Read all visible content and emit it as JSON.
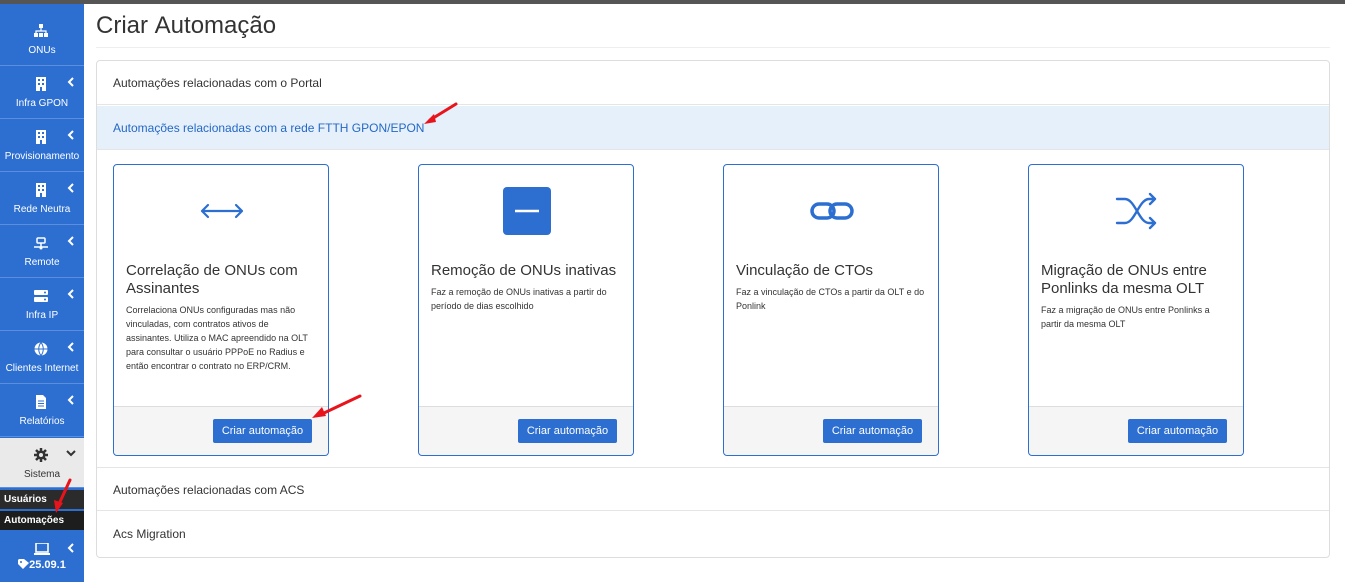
{
  "sidebar": {
    "items": [
      {
        "label": "ONUs",
        "icon": "sitemap-icon"
      },
      {
        "label": "Infra GPON",
        "icon": "building-icon"
      },
      {
        "label": "Provisionamento",
        "icon": "building-icon"
      },
      {
        "label": "Rede Neutra",
        "icon": "building-icon"
      },
      {
        "label": "Remote",
        "icon": "network-icon"
      },
      {
        "label": "Infra IP",
        "icon": "server-icon"
      },
      {
        "label": "Clientes Internet",
        "icon": "globe-icon"
      },
      {
        "label": "Relatórios",
        "icon": "file-icon"
      },
      {
        "label": "Sistema",
        "icon": "gear-icon"
      }
    ],
    "sub_items": [
      "Usuários",
      "Automações"
    ],
    "version": "25.09.1"
  },
  "page": {
    "title_light": "Criar",
    "title_bold": "Automação"
  },
  "sections": {
    "portal": "Automações relacionadas com o Portal",
    "ftth": "Automações relacionadas com a rede FTTH GPON/EPON",
    "acs": "Automações relacionadas com ACS",
    "acs_migration": "Acs Migration"
  },
  "cards": [
    {
      "title": "Correlação de ONUs com Assinantes",
      "description": "Correlaciona ONUs configuradas mas não vinculadas, com contratos ativos de assinantes. Utiliza o MAC apreendido na OLT para consultar o usuário PPPoE no Radius e então encontrar o contrato no ERP/CRM.",
      "button": "Criar automação",
      "icon": "arrows-horizontal-icon"
    },
    {
      "title": "Remoção de ONUs inativas",
      "description": "Faz a remoção de ONUs inativas a partir do período de dias escolhido",
      "button": "Criar automação",
      "icon": "minus-square-icon"
    },
    {
      "title": "Vinculação de CTOs",
      "description": "Faz a vinculação de CTOs a partir da OLT e do Ponlink",
      "button": "Criar automação",
      "icon": "link-icon"
    },
    {
      "title": "Migração de ONUs entre Ponlinks da mesma OLT",
      "description": "Faz a migração de ONUs entre Ponlinks a partir da mesma OLT",
      "button": "Criar automação",
      "icon": "shuffle-icon"
    }
  ],
  "colors": {
    "primary": "#2d6fd1",
    "annotation_arrow": "#e8141b",
    "active_row_bg": "#e6f0fb"
  }
}
